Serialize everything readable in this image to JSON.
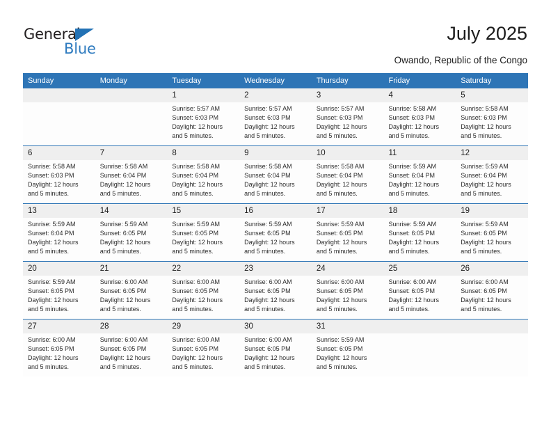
{
  "brand": {
    "name_part1": "General",
    "name_part2": "Blue",
    "accent_color": "#2e7bbf",
    "triangle_color": "#2272b5"
  },
  "header": {
    "title": "July 2025",
    "subtitle": "Owando, Republic of the Congo"
  },
  "theme": {
    "header_bg": "#2e75b6",
    "header_text": "#ffffff",
    "date_row_bg": "#efefef",
    "cell_bg": "#fdfdfd",
    "separator": "#2e75b6"
  },
  "weekdays": [
    "Sunday",
    "Monday",
    "Tuesday",
    "Wednesday",
    "Thursday",
    "Friday",
    "Saturday"
  ],
  "calendar": {
    "month": "July",
    "year": "2025",
    "weeks": [
      [
        {
          "day": "",
          "lines": []
        },
        {
          "day": "",
          "lines": []
        },
        {
          "day": "1",
          "lines": [
            "Sunrise: 5:57 AM",
            "Sunset: 6:03 PM",
            "Daylight: 12 hours",
            "and 5 minutes."
          ]
        },
        {
          "day": "2",
          "lines": [
            "Sunrise: 5:57 AM",
            "Sunset: 6:03 PM",
            "Daylight: 12 hours",
            "and 5 minutes."
          ]
        },
        {
          "day": "3",
          "lines": [
            "Sunrise: 5:57 AM",
            "Sunset: 6:03 PM",
            "Daylight: 12 hours",
            "and 5 minutes."
          ]
        },
        {
          "day": "4",
          "lines": [
            "Sunrise: 5:58 AM",
            "Sunset: 6:03 PM",
            "Daylight: 12 hours",
            "and 5 minutes."
          ]
        },
        {
          "day": "5",
          "lines": [
            "Sunrise: 5:58 AM",
            "Sunset: 6:03 PM",
            "Daylight: 12 hours",
            "and 5 minutes."
          ]
        }
      ],
      [
        {
          "day": "6",
          "lines": [
            "Sunrise: 5:58 AM",
            "Sunset: 6:03 PM",
            "Daylight: 12 hours",
            "and 5 minutes."
          ]
        },
        {
          "day": "7",
          "lines": [
            "Sunrise: 5:58 AM",
            "Sunset: 6:04 PM",
            "Daylight: 12 hours",
            "and 5 minutes."
          ]
        },
        {
          "day": "8",
          "lines": [
            "Sunrise: 5:58 AM",
            "Sunset: 6:04 PM",
            "Daylight: 12 hours",
            "and 5 minutes."
          ]
        },
        {
          "day": "9",
          "lines": [
            "Sunrise: 5:58 AM",
            "Sunset: 6:04 PM",
            "Daylight: 12 hours",
            "and 5 minutes."
          ]
        },
        {
          "day": "10",
          "lines": [
            "Sunrise: 5:58 AM",
            "Sunset: 6:04 PM",
            "Daylight: 12 hours",
            "and 5 minutes."
          ]
        },
        {
          "day": "11",
          "lines": [
            "Sunrise: 5:59 AM",
            "Sunset: 6:04 PM",
            "Daylight: 12 hours",
            "and 5 minutes."
          ]
        },
        {
          "day": "12",
          "lines": [
            "Sunrise: 5:59 AM",
            "Sunset: 6:04 PM",
            "Daylight: 12 hours",
            "and 5 minutes."
          ]
        }
      ],
      [
        {
          "day": "13",
          "lines": [
            "Sunrise: 5:59 AM",
            "Sunset: 6:04 PM",
            "Daylight: 12 hours",
            "and 5 minutes."
          ]
        },
        {
          "day": "14",
          "lines": [
            "Sunrise: 5:59 AM",
            "Sunset: 6:05 PM",
            "Daylight: 12 hours",
            "and 5 minutes."
          ]
        },
        {
          "day": "15",
          "lines": [
            "Sunrise: 5:59 AM",
            "Sunset: 6:05 PM",
            "Daylight: 12 hours",
            "and 5 minutes."
          ]
        },
        {
          "day": "16",
          "lines": [
            "Sunrise: 5:59 AM",
            "Sunset: 6:05 PM",
            "Daylight: 12 hours",
            "and 5 minutes."
          ]
        },
        {
          "day": "17",
          "lines": [
            "Sunrise: 5:59 AM",
            "Sunset: 6:05 PM",
            "Daylight: 12 hours",
            "and 5 minutes."
          ]
        },
        {
          "day": "18",
          "lines": [
            "Sunrise: 5:59 AM",
            "Sunset: 6:05 PM",
            "Daylight: 12 hours",
            "and 5 minutes."
          ]
        },
        {
          "day": "19",
          "lines": [
            "Sunrise: 5:59 AM",
            "Sunset: 6:05 PM",
            "Daylight: 12 hours",
            "and 5 minutes."
          ]
        }
      ],
      [
        {
          "day": "20",
          "lines": [
            "Sunrise: 5:59 AM",
            "Sunset: 6:05 PM",
            "Daylight: 12 hours",
            "and 5 minutes."
          ]
        },
        {
          "day": "21",
          "lines": [
            "Sunrise: 6:00 AM",
            "Sunset: 6:05 PM",
            "Daylight: 12 hours",
            "and 5 minutes."
          ]
        },
        {
          "day": "22",
          "lines": [
            "Sunrise: 6:00 AM",
            "Sunset: 6:05 PM",
            "Daylight: 12 hours",
            "and 5 minutes."
          ]
        },
        {
          "day": "23",
          "lines": [
            "Sunrise: 6:00 AM",
            "Sunset: 6:05 PM",
            "Daylight: 12 hours",
            "and 5 minutes."
          ]
        },
        {
          "day": "24",
          "lines": [
            "Sunrise: 6:00 AM",
            "Sunset: 6:05 PM",
            "Daylight: 12 hours",
            "and 5 minutes."
          ]
        },
        {
          "day": "25",
          "lines": [
            "Sunrise: 6:00 AM",
            "Sunset: 6:05 PM",
            "Daylight: 12 hours",
            "and 5 minutes."
          ]
        },
        {
          "day": "26",
          "lines": [
            "Sunrise: 6:00 AM",
            "Sunset: 6:05 PM",
            "Daylight: 12 hours",
            "and 5 minutes."
          ]
        }
      ],
      [
        {
          "day": "27",
          "lines": [
            "Sunrise: 6:00 AM",
            "Sunset: 6:05 PM",
            "Daylight: 12 hours",
            "and 5 minutes."
          ]
        },
        {
          "day": "28",
          "lines": [
            "Sunrise: 6:00 AM",
            "Sunset: 6:05 PM",
            "Daylight: 12 hours",
            "and 5 minutes."
          ]
        },
        {
          "day": "29",
          "lines": [
            "Sunrise: 6:00 AM",
            "Sunset: 6:05 PM",
            "Daylight: 12 hours",
            "and 5 minutes."
          ]
        },
        {
          "day": "30",
          "lines": [
            "Sunrise: 6:00 AM",
            "Sunset: 6:05 PM",
            "Daylight: 12 hours",
            "and 5 minutes."
          ]
        },
        {
          "day": "31",
          "lines": [
            "Sunrise: 5:59 AM",
            "Sunset: 6:05 PM",
            "Daylight: 12 hours",
            "and 5 minutes."
          ]
        },
        {
          "day": "",
          "lines": []
        },
        {
          "day": "",
          "lines": []
        }
      ]
    ]
  }
}
